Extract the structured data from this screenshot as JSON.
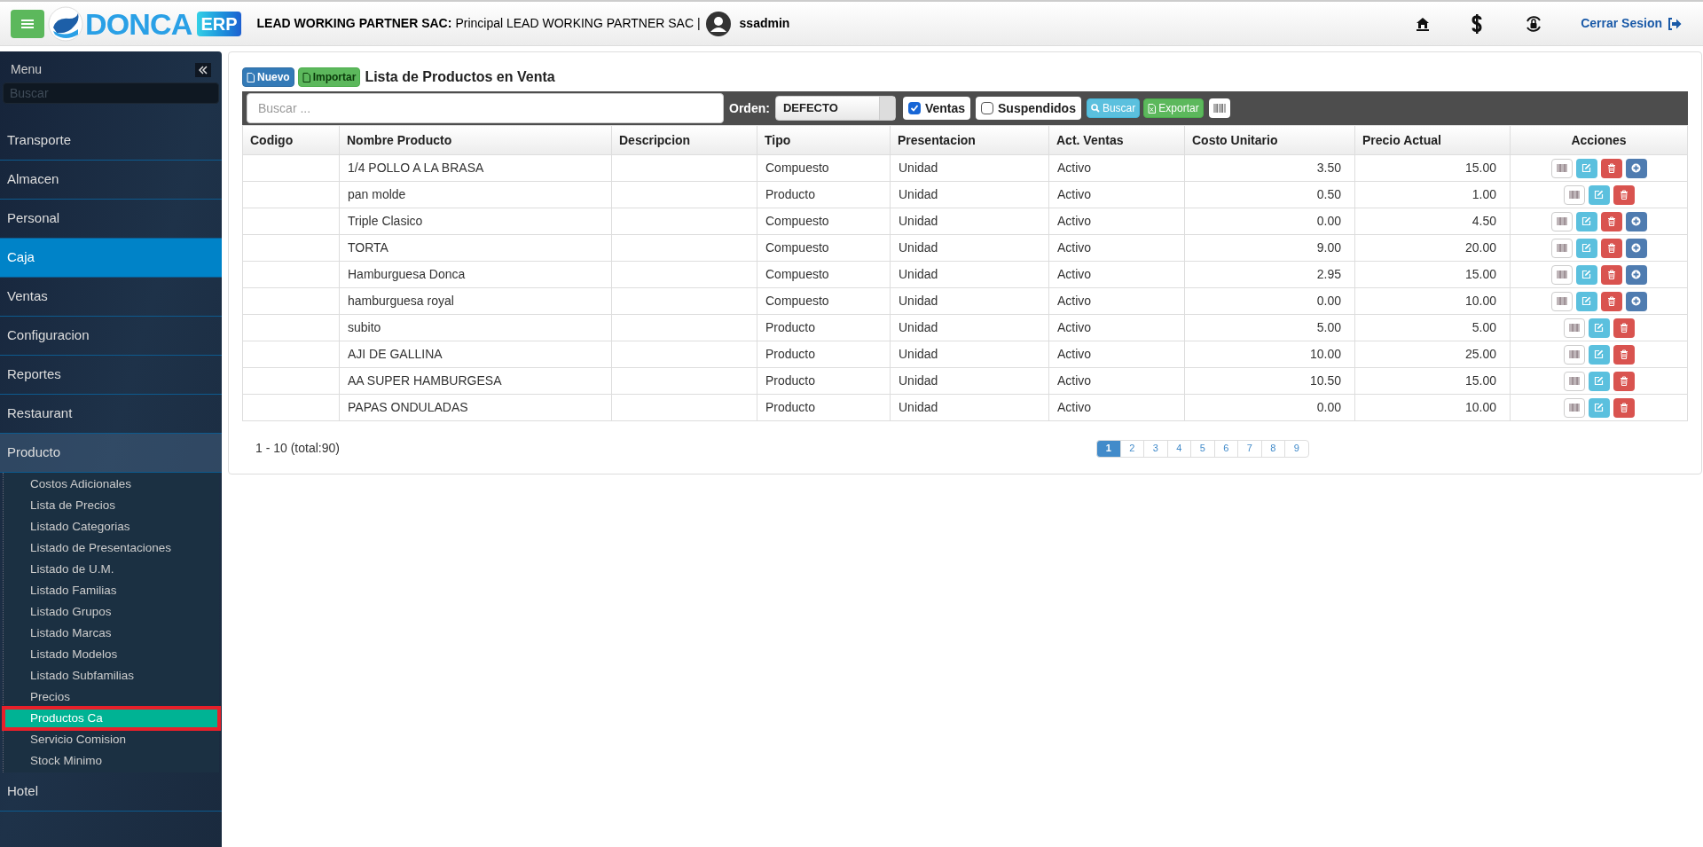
{
  "header": {
    "logo_text": "DONCA",
    "logo_badge": "ERP",
    "company": "LEAD WORKING PARTNER SAC:",
    "branch": "Principal LEAD WORKING PARTNER SAC |",
    "user": "ssadmin",
    "logout": "Cerrar Sesion"
  },
  "sidebar": {
    "title": "Menu",
    "search": {
      "placeholder": "Buscar"
    },
    "items": [
      {
        "label": "Transporte",
        "selected": false
      },
      {
        "label": "Almacen",
        "selected": false
      },
      {
        "label": "Personal",
        "selected": false
      },
      {
        "label": "Caja",
        "selected": true
      },
      {
        "label": "Ventas",
        "selected": false
      },
      {
        "label": "Configuracion",
        "selected": false
      },
      {
        "label": "Reportes",
        "selected": false
      },
      {
        "label": "Restaurant",
        "selected": false
      },
      {
        "label": "Producto",
        "selected": false,
        "expanded": true,
        "children": [
          {
            "label": "Costos Adicionales",
            "selected": false,
            "highlighted": false
          },
          {
            "label": "Lista de Precios",
            "selected": false,
            "highlighted": false
          },
          {
            "label": "Listado Categorias",
            "selected": false,
            "highlighted": false
          },
          {
            "label": "Listado de Presentaciones",
            "selected": false,
            "highlighted": false
          },
          {
            "label": "Listado de U.M.",
            "selected": false,
            "highlighted": false
          },
          {
            "label": "Listado Familias",
            "selected": false,
            "highlighted": false
          },
          {
            "label": "Listado Grupos",
            "selected": false,
            "highlighted": false
          },
          {
            "label": "Listado Marcas",
            "selected": false,
            "highlighted": false
          },
          {
            "label": "Listado Modelos",
            "selected": false,
            "highlighted": false
          },
          {
            "label": "Listado Subfamilias",
            "selected": false,
            "highlighted": false
          },
          {
            "label": "Precios",
            "selected": false,
            "highlighted": false
          },
          {
            "label": "Productos Ca",
            "selected": true,
            "highlighted": true
          },
          {
            "label": "Servicio Comision",
            "selected": false,
            "highlighted": false
          },
          {
            "label": "Stock Minimo",
            "selected": false,
            "highlighted": false
          }
        ]
      },
      {
        "label": "Hotel",
        "selected": false
      }
    ]
  },
  "panel": {
    "buttons": [
      {
        "label": "Nuevo",
        "kind": "primary"
      },
      {
        "label": "Importar",
        "kind": "success"
      }
    ],
    "title": "Lista de Productos en Venta",
    "toolbar": {
      "search": {
        "placeholder": "Buscar ..."
      },
      "order_label": "Orden:",
      "order_value": "DEFECTO",
      "checks": [
        {
          "label": "Ventas",
          "checked": true
        },
        {
          "label": "Suspendidos",
          "checked": false
        }
      ],
      "buttons": [
        {
          "label": "Buscar",
          "kind": "info"
        },
        {
          "label": "Exportar",
          "kind": "success"
        }
      ]
    },
    "table": {
      "columns": [
        "Codigo",
        "Nombre Producto",
        "Descripcion",
        "Tipo",
        "Presentacion",
        "Act. Ventas",
        "Costo Unitario",
        "Precio Actual",
        "Acciones"
      ],
      "rows": [
        {
          "kind": "composite",
          "cells": [
            "",
            "1/4 POLLO A LA BRASA",
            "",
            "Compuesto",
            "Unidad",
            "Activo",
            "3.50",
            "15.00"
          ]
        },
        {
          "kind": "simple",
          "cells": [
            "",
            "pan molde",
            "",
            "Producto",
            "Unidad",
            "Activo",
            "0.50",
            "1.00"
          ]
        },
        {
          "kind": "composite",
          "cells": [
            "",
            "Triple Clasico",
            "",
            "Compuesto",
            "Unidad",
            "Activo",
            "0.00",
            "4.50"
          ]
        },
        {
          "kind": "composite",
          "cells": [
            "",
            "TORTA",
            "",
            "Compuesto",
            "Unidad",
            "Activo",
            "9.00",
            "20.00"
          ]
        },
        {
          "kind": "composite",
          "cells": [
            "",
            "Hamburguesa Donca",
            "",
            "Compuesto",
            "Unidad",
            "Activo",
            "2.95",
            "15.00"
          ]
        },
        {
          "kind": "composite",
          "cells": [
            "",
            "hamburguesa royal",
            "",
            "Compuesto",
            "Unidad",
            "Activo",
            "0.00",
            "10.00"
          ]
        },
        {
          "kind": "simple",
          "cells": [
            "",
            "subito",
            "",
            "Producto",
            "Unidad",
            "Activo",
            "5.00",
            "5.00"
          ]
        },
        {
          "kind": "simple",
          "cells": [
            "",
            "AJI DE GALLINA",
            "",
            "Producto",
            "Unidad",
            "Activo",
            "10.00",
            "25.00"
          ]
        },
        {
          "kind": "simple",
          "cells": [
            "",
            "AA SUPER HAMBURGESA",
            "",
            "Producto",
            "Unidad",
            "Activo",
            "10.50",
            "15.00"
          ]
        },
        {
          "kind": "simple",
          "cells": [
            "",
            "PAPAS ONDULADAS",
            "",
            "Producto",
            "Unidad",
            "Activo",
            "0.00",
            "10.00"
          ]
        }
      ]
    },
    "summary": "1 - 10 (total:90)",
    "pages": [
      {
        "label": "1",
        "selected": true
      },
      {
        "label": "2",
        "selected": false
      },
      {
        "label": "3",
        "selected": false
      },
      {
        "label": "4",
        "selected": false
      },
      {
        "label": "5",
        "selected": false
      },
      {
        "label": "6",
        "selected": false
      },
      {
        "label": "7",
        "selected": false
      },
      {
        "label": "8",
        "selected": false
      },
      {
        "label": "9",
        "selected": false
      }
    ]
  }
}
